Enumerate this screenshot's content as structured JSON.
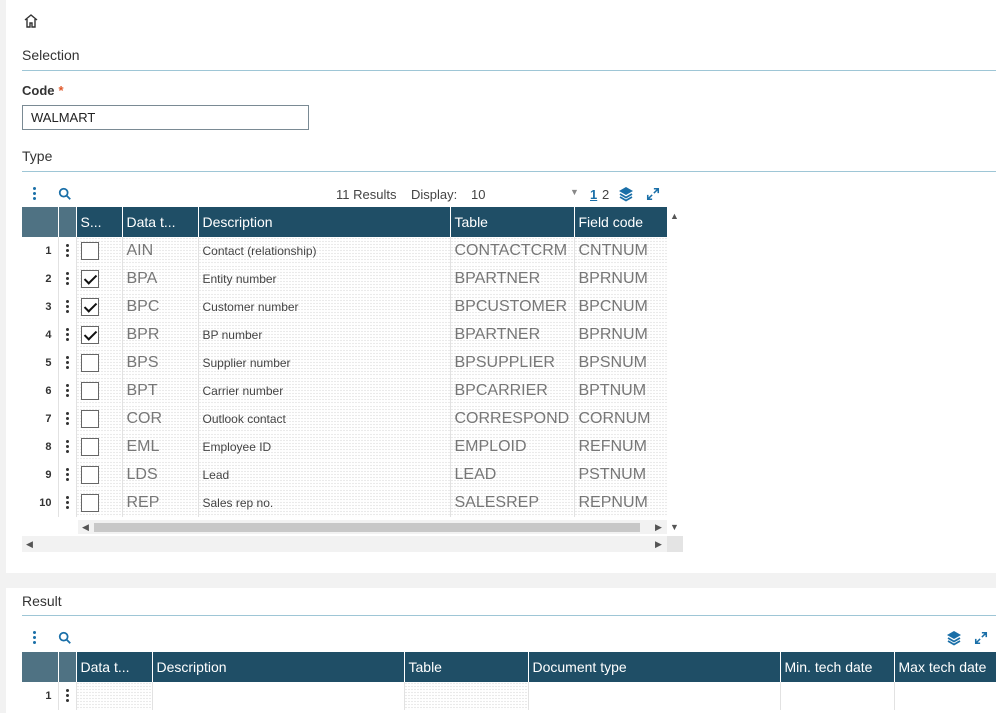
{
  "selection": {
    "title": "Selection",
    "code_label": "Code",
    "required_mark": "*",
    "code_value": "WALMART",
    "type_label": "Type"
  },
  "type_grid": {
    "results_text": "11 Results",
    "display_label": "Display:",
    "display_value": "10",
    "pages": [
      "1",
      "2"
    ],
    "columns": [
      "S...",
      "Data t...",
      "Description",
      "Table",
      "Field code"
    ],
    "rows": [
      {
        "n": "1",
        "checked": false,
        "data_type": "AIN",
        "description": "Contact (relationship)",
        "table": "CONTACTCRM",
        "field_code": "CNTNUM"
      },
      {
        "n": "2",
        "checked": true,
        "data_type": "BPA",
        "description": "Entity number",
        "table": "BPARTNER",
        "field_code": "BPRNUM"
      },
      {
        "n": "3",
        "checked": true,
        "data_type": "BPC",
        "description": "Customer number",
        "table": "BPCUSTOMER",
        "field_code": "BPCNUM"
      },
      {
        "n": "4",
        "checked": true,
        "data_type": "BPR",
        "description": "BP number",
        "table": "BPARTNER",
        "field_code": "BPRNUM"
      },
      {
        "n": "5",
        "checked": false,
        "data_type": "BPS",
        "description": "Supplier number",
        "table": "BPSUPPLIER",
        "field_code": "BPSNUM"
      },
      {
        "n": "6",
        "checked": false,
        "data_type": "BPT",
        "description": "Carrier number",
        "table": "BPCARRIER",
        "field_code": "BPTNUM"
      },
      {
        "n": "7",
        "checked": false,
        "data_type": "COR",
        "description": "Outlook contact",
        "table": "CORRESPOND",
        "field_code": "CORNUM"
      },
      {
        "n": "8",
        "checked": false,
        "data_type": "EML",
        "description": "Employee ID",
        "table": "EMPLOID",
        "field_code": "REFNUM"
      },
      {
        "n": "9",
        "checked": false,
        "data_type": "LDS",
        "description": "Lead",
        "table": "LEAD",
        "field_code": "PSTNUM"
      },
      {
        "n": "10",
        "checked": false,
        "data_type": "REP",
        "description": "Sales rep no.",
        "table": "SALESREP",
        "field_code": "REPNUM"
      }
    ]
  },
  "result": {
    "title": "Result",
    "columns": [
      "Data t...",
      "Description",
      "Table",
      "Document type",
      "Min. tech date",
      "Max tech date"
    ],
    "rows": [
      {
        "n": "1"
      }
    ]
  },
  "colors": {
    "header": "#1f4e66",
    "accent": "#1a6fa8",
    "required": "#e0582a"
  }
}
